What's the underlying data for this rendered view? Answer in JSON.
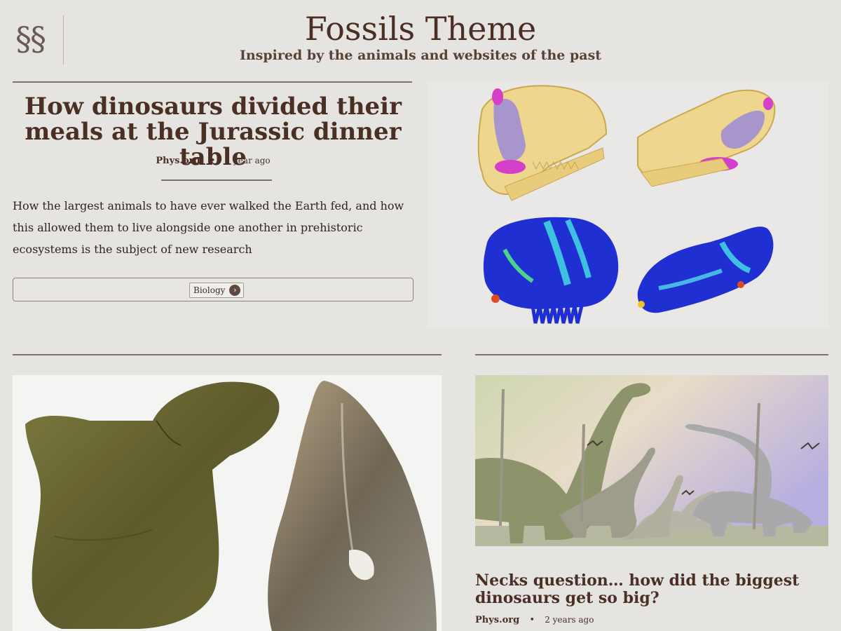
{
  "header": {
    "logo_text": "§§",
    "title": "Fossils Theme",
    "tagline": "Inspired by the animals and websites of the past"
  },
  "featured": {
    "title": "How dinosaurs divided their meals at the Jurassic dinner table",
    "source": "Phys.org",
    "separator": "•",
    "time": "1 year ago",
    "excerpt": "How the largest animals to have ever walked the Earth fed, and how this allowed them to live alongside one another in prehistoric ecosystems is the subject of new research",
    "tag": "Biology",
    "tag_icon": "chevron-right-icon"
  },
  "card_fossil": {
    "image": "fossil-bone-and-tooth"
  },
  "card_necks": {
    "title": "Necks question… how did the biggest dinosaurs get so big?",
    "source": "Phys.org",
    "separator": "•",
    "time": "2 years ago",
    "image": "sauropod-herd-illustration"
  },
  "colors": {
    "background": "#e6e4e0",
    "text": "#4a2f24",
    "rule": "#7d736c"
  }
}
